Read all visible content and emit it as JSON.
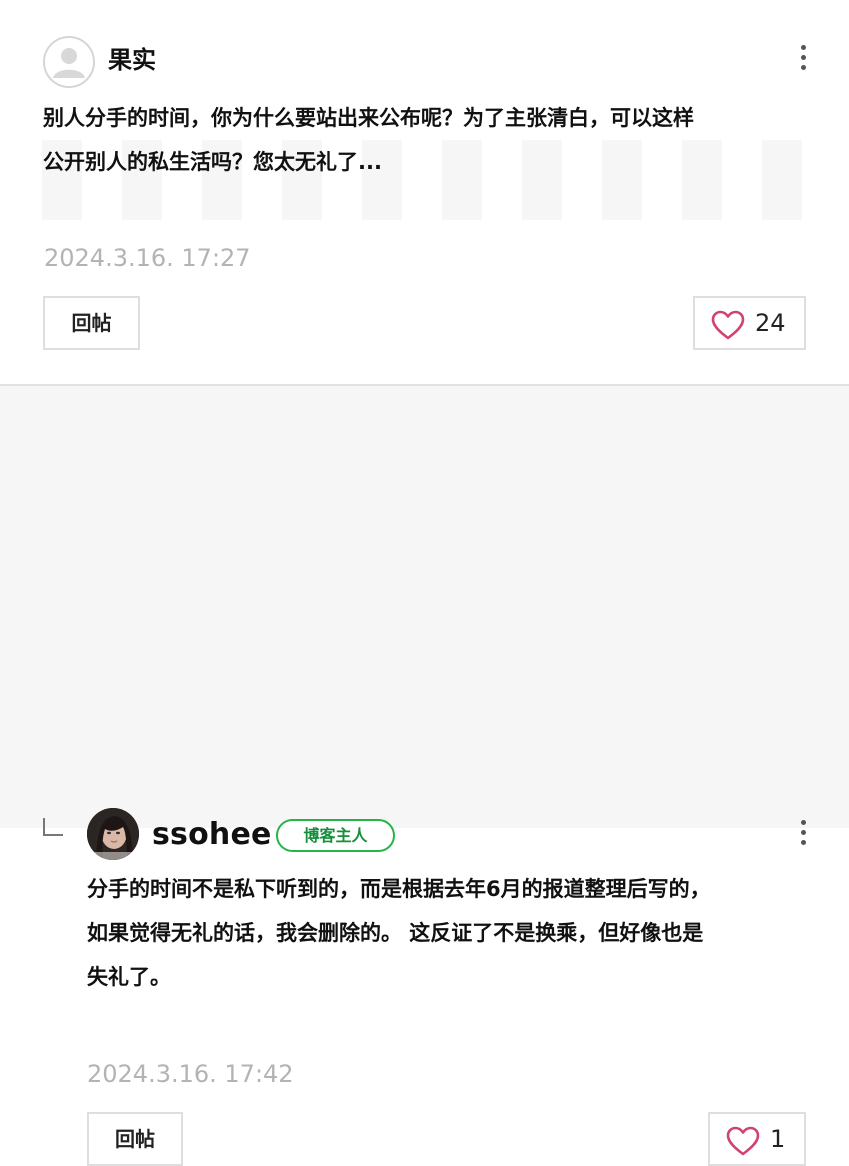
{
  "comments": [
    {
      "username": "果实",
      "text_lines": [
        "别人分手的时间，你为什么要站出来公布呢？为了主张清白，可以这样",
        "公开别人的私生活吗？您太无礼了..."
      ],
      "timestamp": "2024.3.16. 17:27",
      "reply_label": "回帖",
      "like_count": "24",
      "avatar_icon": "default-user-icon",
      "more_icon": "more-vertical-icon",
      "like_icon": "heart-outline-icon"
    },
    {
      "username": "ssohee",
      "badge": "博客主人",
      "text_lines": [
        "分手的时间不是私下听到的，而是根据去年6月的报道整理后写的，",
        "如果觉得无礼的话，我会删除的。 这反证了不是换乘，但好像也是",
        "失礼了。"
      ],
      "timestamp": "2024.3.16. 17:42",
      "reply_label": "回帖",
      "like_count": "1",
      "avatar_icon": "user-photo",
      "more_icon": "more-vertical-icon",
      "like_icon": "heart-outline-icon",
      "reply_indicator_icon": "reply-arrow-icon"
    }
  ],
  "colors": {
    "badge_green": "#27b34a",
    "heart_pink": "#d1436f",
    "timestamp_gray": "#b3b3b3",
    "reply_background": "#f6f6f6"
  }
}
